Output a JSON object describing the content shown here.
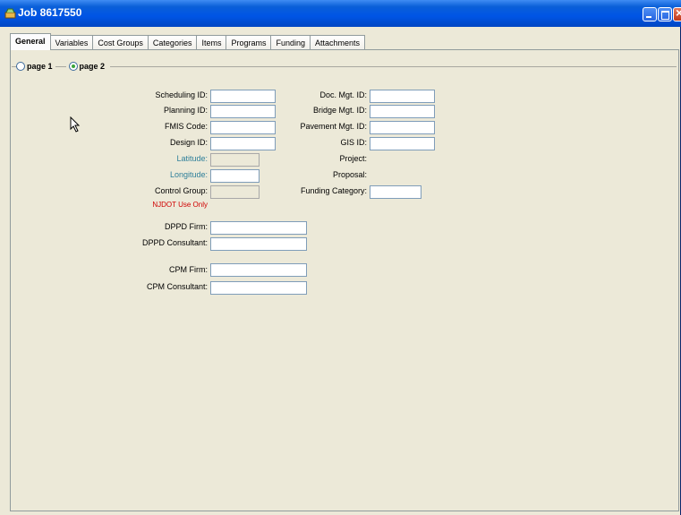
{
  "window": {
    "title": "Job 8617550"
  },
  "tabs": [
    "General",
    "Variables",
    "Cost Groups",
    "Categories",
    "Items",
    "Programs",
    "Funding",
    "Attachments"
  ],
  "pages": {
    "page1": "page 1",
    "page2": "page 2",
    "selected": "page 2"
  },
  "left_fields": {
    "scheduling_id": "Scheduling ID:",
    "planning_id": "Planning ID:",
    "fmis_code": "FMIS Code:",
    "design_id": "Design ID:",
    "latitude": "Latitude:",
    "longitude": "Longitude:",
    "control_group": "Control Group:",
    "njdot_note": "NJDOT Use Only",
    "dppd_firm": "DPPD Firm:",
    "dppd_consultant": "DPPD Consultant:",
    "cpm_firm": "CPM Firm:",
    "cpm_consultant": "CPM Consultant:"
  },
  "right_fields": {
    "doc_mgt_id": "Doc. Mgt. ID:",
    "bridge_mgt_id": "Bridge Mgt. ID:",
    "pavement_mgt_id": "Pavement Mgt. ID:",
    "gis_id": "GIS ID:",
    "project": "Project:",
    "proposal": "Proposal:",
    "funding_category": "Funding Category:"
  },
  "colors": {
    "titlebar": "#0055e5",
    "background": "#ece9d8",
    "teal_label": "#2e7f9a",
    "note_red": "#d00000"
  }
}
